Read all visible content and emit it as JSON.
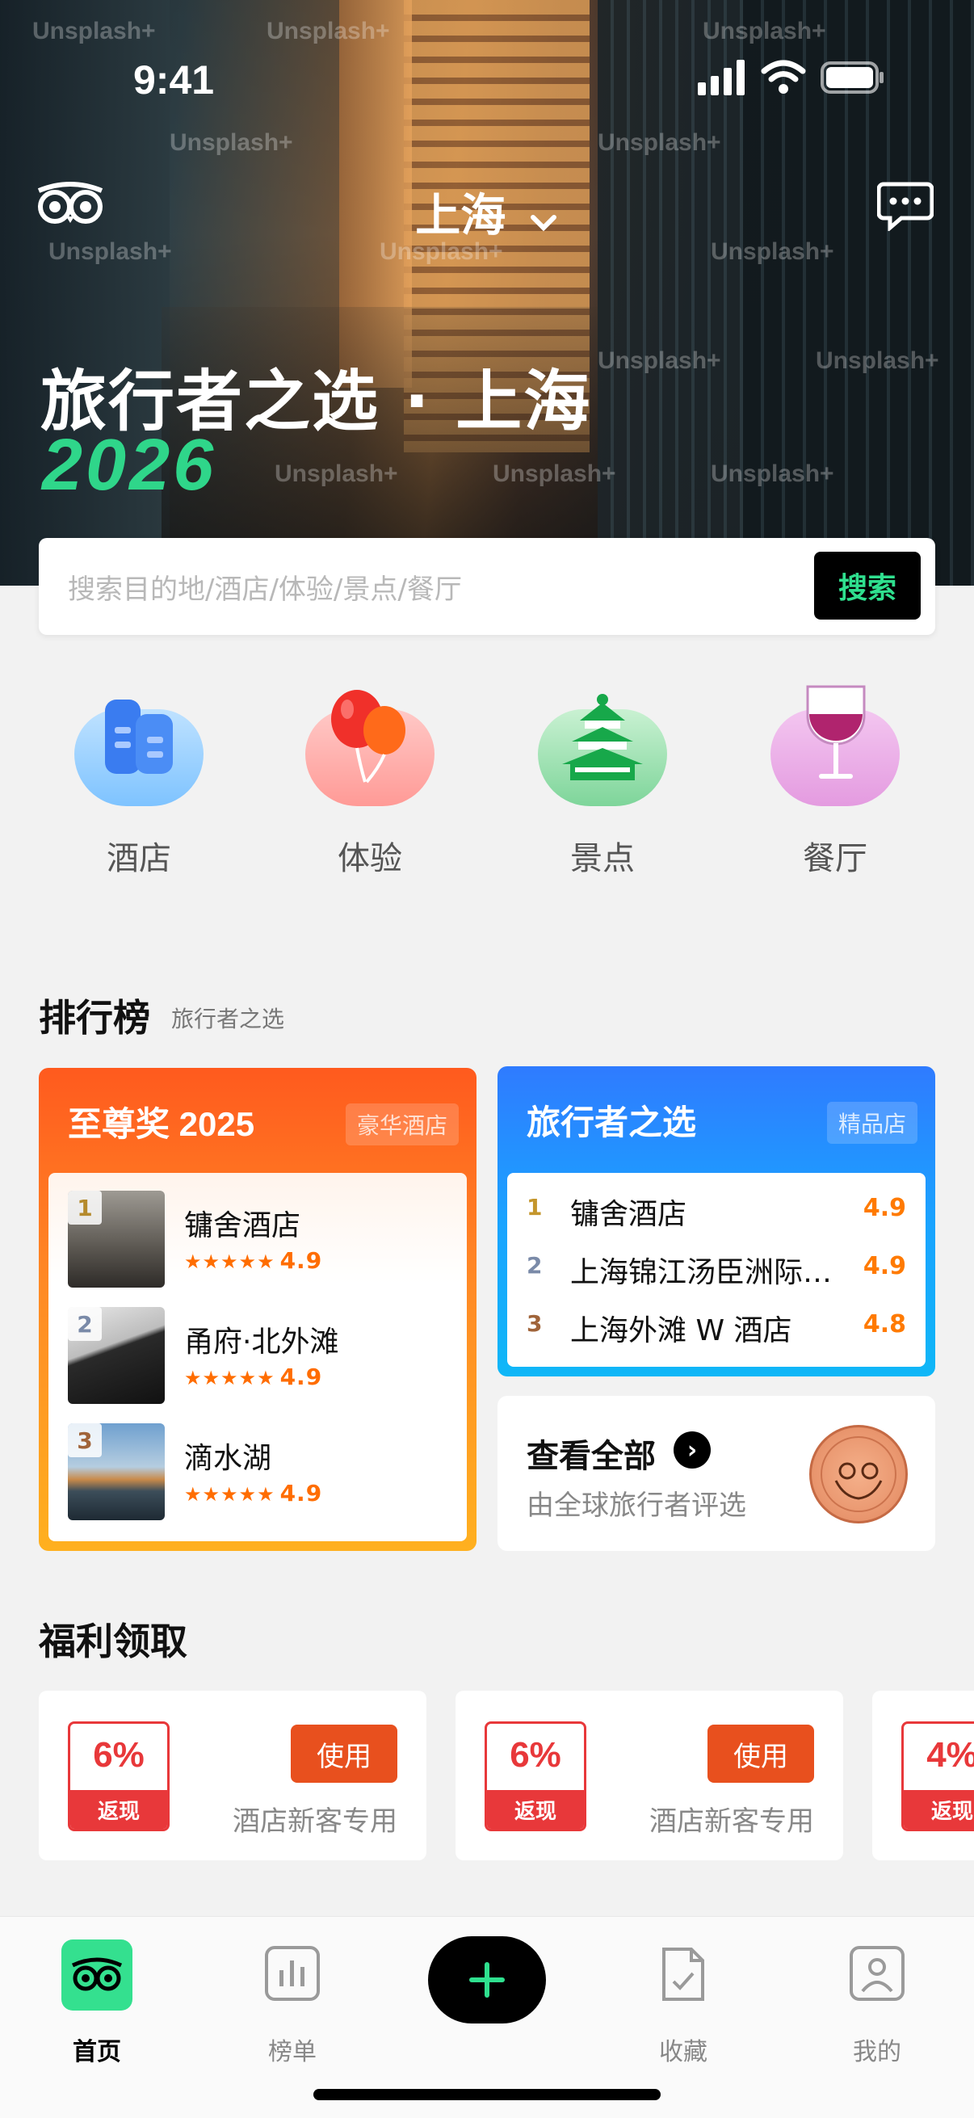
{
  "status_bar": {
    "time": "9:41"
  },
  "header": {
    "city": "上海",
    "hero_title": "旅行者之选 · 上海",
    "hero_year": "2026",
    "watermark": "Unsplash+"
  },
  "search": {
    "placeholder": "搜索目的地/酒店/体验/景点/餐厅",
    "button": "搜索"
  },
  "categories": [
    {
      "label": "酒店",
      "icon": "hotel-building-icon"
    },
    {
      "label": "体验",
      "icon": "balloon-icon"
    },
    {
      "label": "景点",
      "icon": "temple-icon"
    },
    {
      "label": "餐厅",
      "icon": "wine-glass-icon"
    }
  ],
  "ranking": {
    "title": "排行榜",
    "subtitle": "旅行者之选",
    "left_card": {
      "title": "至尊奖 2025",
      "tag": "豪华酒店",
      "items": [
        {
          "rank": "1",
          "name": "镛舍酒店",
          "stars": "★★★★★",
          "score": "4.9"
        },
        {
          "rank": "2",
          "name": "甬府·北外滩",
          "stars": "★★★★★",
          "score": "4.9"
        },
        {
          "rank": "3",
          "name": "滴水湖",
          "stars": "★★★★★",
          "score": "4.9"
        }
      ]
    },
    "right_card": {
      "title": "旅行者之选",
      "tag": "精品店",
      "items": [
        {
          "rank": "1",
          "name": "镛舍酒店",
          "score": "4.9"
        },
        {
          "rank": "2",
          "name": "上海锦江汤臣洲际…",
          "score": "4.9"
        },
        {
          "rank": "3",
          "name": "上海外滩 W 酒店",
          "score": "4.8"
        }
      ]
    },
    "view_all": {
      "title": "查看全部",
      "subtitle": "由全球旅行者评选"
    }
  },
  "benefits": {
    "title": "福利领取",
    "coupons": [
      {
        "percent": "6%",
        "band": "返现",
        "button": "使用",
        "desc": "酒店新客专用"
      },
      {
        "percent": "6%",
        "band": "返现",
        "button": "使用",
        "desc": "酒店新客专用"
      },
      {
        "percent": "4%",
        "band": "返现"
      }
    ]
  },
  "tabbar": {
    "items": [
      {
        "label": "首页",
        "icon": "owl-icon",
        "active": true
      },
      {
        "label": "榜单",
        "icon": "chart-icon"
      },
      {
        "label": "",
        "icon": "plus-icon"
      },
      {
        "label": "收藏",
        "icon": "document-check-icon"
      },
      {
        "label": "我的",
        "icon": "user-icon"
      }
    ]
  },
  "colors": {
    "accent_green": "#2fd68a",
    "orange": "#ff6d00",
    "blue": "#2f7bff",
    "red": "#e8383a"
  }
}
